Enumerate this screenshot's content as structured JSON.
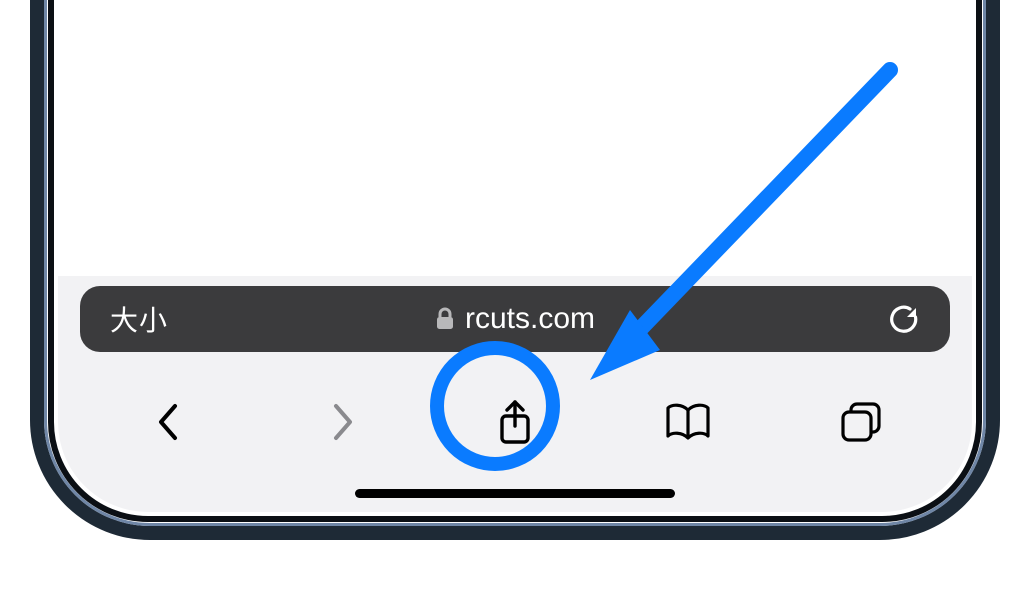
{
  "addressBar": {
    "readerLabel": "大小",
    "domain": "rcuts.com",
    "lockIconName": "lock-icon",
    "reloadIconName": "reload-icon"
  },
  "toolbar": {
    "back": {
      "iconName": "chevron-left-icon"
    },
    "forward": {
      "iconName": "chevron-right-icon"
    },
    "share": {
      "iconName": "share-icon"
    },
    "bookmarks": {
      "iconName": "book-icon"
    },
    "tabs": {
      "iconName": "tabs-icon"
    }
  },
  "annotation": {
    "color": "#0a7bff",
    "highlightTarget": "share-button"
  }
}
